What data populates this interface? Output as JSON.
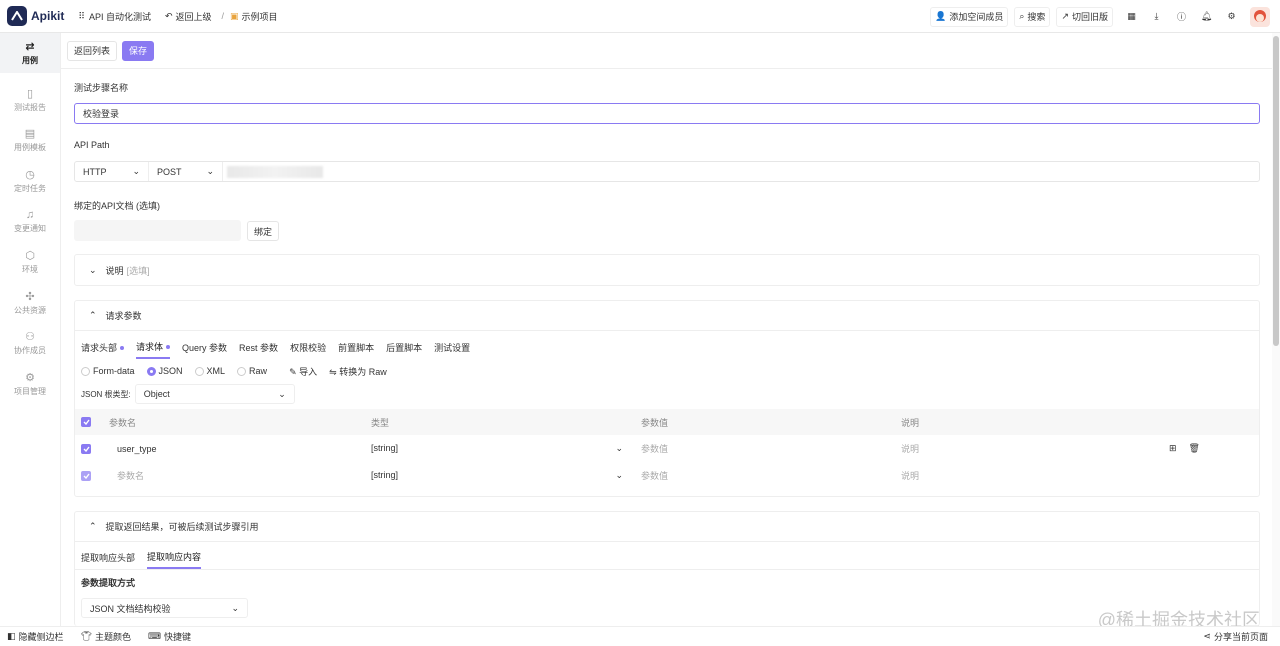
{
  "app": {
    "name": "Apikit",
    "project": "API 自动化测试",
    "back": "返回上级",
    "example": "示例项目"
  },
  "top_actions": {
    "add_member": "添加空间成员",
    "search": "搜索",
    "old_version": "切回旧版"
  },
  "sidebar": {
    "items": [
      {
        "label": "用例",
        "icon": "arrows-icon"
      },
      {
        "label": "测试报告",
        "icon": "report-icon"
      },
      {
        "label": "用例模板",
        "icon": "template-icon"
      },
      {
        "label": "定时任务",
        "icon": "clock-icon"
      },
      {
        "label": "变更通知",
        "icon": "bell-icon"
      },
      {
        "label": "环境",
        "icon": "env-icon"
      },
      {
        "label": "公共资源",
        "icon": "puzzle-icon"
      },
      {
        "label": "协作成员",
        "icon": "users-icon"
      },
      {
        "label": "项目管理",
        "icon": "gear-icon"
      }
    ]
  },
  "toolbar": {
    "back_list": "返回列表",
    "save": "保存"
  },
  "form": {
    "step_name_label": "测试步骤名称",
    "step_name_value": "校验登录",
    "api_path_label": "API Path",
    "protocol": "HTTP",
    "method": "POST",
    "bind_label": "绑定的API文档 (选填)",
    "bind_button": "绑定"
  },
  "desc_panel": {
    "title": "说明",
    "optional": "[选填]"
  },
  "params_panel": {
    "title": "请求参数",
    "tabs": [
      "请求头部",
      "请求体",
      "Query 参数",
      "Rest 参数",
      "权限校验",
      "前置脚本",
      "后置脚本",
      "测试设置"
    ],
    "body_types": [
      "Form-data",
      "JSON",
      "XML",
      "Raw"
    ],
    "import": "导入",
    "convert": "转换为 Raw",
    "json_root_label": "JSON 根类型:",
    "json_root_value": "Object",
    "columns": [
      "参数名",
      "类型",
      "参数值",
      "说明"
    ],
    "rows": [
      {
        "name": "user_type",
        "type": "[string]",
        "value": "参数值",
        "desc": "说明"
      },
      {
        "name": "参数名",
        "type": "[string]",
        "value": "参数值",
        "desc": "说明"
      }
    ]
  },
  "extract_panel": {
    "title": "提取返回结果，可被后续测试步骤引用",
    "tabs": [
      "提取响应头部",
      "提取响应内容"
    ],
    "method_label": "参数提取方式",
    "method_value": "JSON 文档结构校验"
  },
  "footer": {
    "hide_sidebar": "隐藏侧边栏",
    "theme": "主题颜色",
    "shortcuts": "快捷键",
    "share": "分享当前页面"
  },
  "watermark": "@稀土掘金技术社区",
  "colors": {
    "accent": "#8a7af2",
    "brand": "#1f2a55"
  }
}
